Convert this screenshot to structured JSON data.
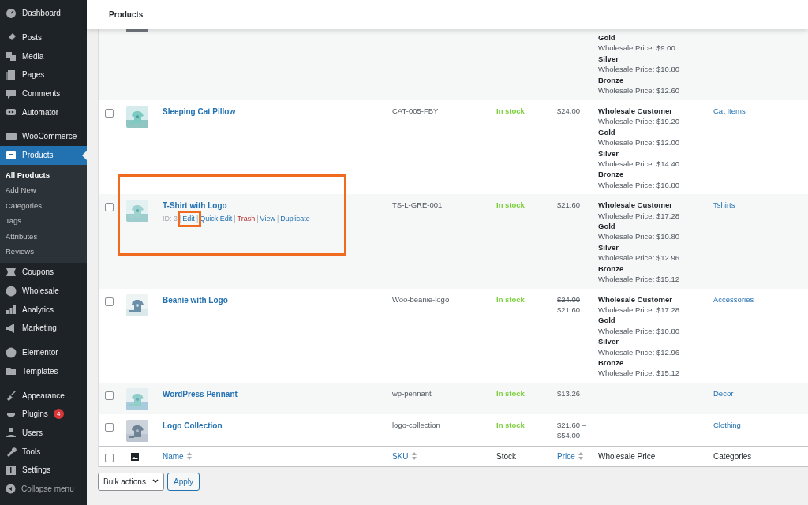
{
  "sidebar": {
    "groups": [
      [
        {
          "label": "Dashboard",
          "selected": false
        }
      ],
      [
        {
          "label": "Posts",
          "selected": false
        },
        {
          "label": "Media",
          "selected": false
        },
        {
          "label": "Pages",
          "selected": false
        },
        {
          "label": "Comments",
          "selected": false
        },
        {
          "label": "Automator",
          "selected": false
        }
      ],
      [
        {
          "label": "WooCommerce",
          "selected": false
        },
        {
          "label": "Products",
          "selected": true,
          "children": [
            {
              "label": "All Products",
              "selected": true
            },
            {
              "label": "Add New",
              "selected": false
            },
            {
              "label": "Categories",
              "selected": false
            },
            {
              "label": "Tags",
              "selected": false
            },
            {
              "label": "Attributes",
              "selected": false
            },
            {
              "label": "Reviews",
              "selected": false
            }
          ]
        },
        {
          "label": "Coupons",
          "selected": false
        },
        {
          "label": "Wholesale",
          "selected": false
        },
        {
          "label": "Analytics",
          "selected": false
        },
        {
          "label": "Marketing",
          "selected": false
        }
      ],
      [
        {
          "label": "Elementor",
          "selected": false
        },
        {
          "label": "Templates",
          "selected": false
        }
      ],
      [
        {
          "label": "Appearance",
          "selected": false
        },
        {
          "label": "Plugins",
          "selected": false,
          "badge": "4"
        },
        {
          "label": "Users",
          "selected": false
        },
        {
          "label": "Tools",
          "selected": false
        },
        {
          "label": "Settings",
          "selected": false
        }
      ]
    ],
    "collapse_label": "Collapse menu"
  },
  "header": {
    "title": "Products"
  },
  "rows": [
    {
      "cut_top": true,
      "wholesale": [
        {
          "tier": "Gold",
          "price": "Wholesale Price: $9.00"
        },
        {
          "tier": "Silver",
          "price": "Wholesale Price: $10.80"
        },
        {
          "tier": "Bronze",
          "price": "Wholesale Price: $12.60"
        }
      ]
    },
    {
      "checked": false,
      "name": "Sleeping Cat Pillow",
      "sku": "CAT-005-FBY",
      "stock": "In stock",
      "price": [
        {
          "text": "$24.00",
          "struck": false
        }
      ],
      "wholesale": [
        {
          "tier": "Wholesale Customer",
          "price": "Wholesale Price: $19.20"
        },
        {
          "tier": "Gold",
          "price": "Wholesale Price: $12.00"
        },
        {
          "tier": "Silver",
          "price": "Wholesale Price: $14.40"
        },
        {
          "tier": "Bronze",
          "price": "Wholesale Price: $16.80"
        }
      ],
      "category": "Cat Items"
    },
    {
      "checked": false,
      "highlighted": true,
      "name": "T-Shirt with Logo",
      "id_text": "ID: 3",
      "actions": [
        {
          "separator": "|",
          "label": "Edit",
          "kind": "link",
          "highlighted": true
        },
        {
          "separator": "|",
          "label": "Quick Edit",
          "kind": "link",
          "highlighted": false
        },
        {
          "separator": "|",
          "label": "Trash",
          "kind": "trash",
          "highlighted": false
        },
        {
          "separator": "|",
          "label": "View",
          "kind": "link",
          "highlighted": false
        },
        {
          "separator": "|",
          "label": "Duplicate",
          "kind": "link",
          "highlighted": false
        }
      ],
      "sku": "TS-L-GRE-001",
      "stock": "In stock",
      "price": [
        {
          "text": "$21.60",
          "struck": false
        }
      ],
      "wholesale": [
        {
          "tier": "Wholesale Customer",
          "price": "Wholesale Price: $17.28"
        },
        {
          "tier": "Gold",
          "price": "Wholesale Price: $10.80"
        },
        {
          "tier": "Silver",
          "price": "Wholesale Price: $12.96"
        },
        {
          "tier": "Bronze",
          "price": "Wholesale Price: $15.12"
        }
      ],
      "category": "Tshirts"
    },
    {
      "checked": false,
      "name": "Beanie with Logo",
      "sku": "Woo-beanie-logo",
      "stock": "In stock",
      "price": [
        {
          "text": "$24.00",
          "struck": true
        },
        {
          "text": "$21.60",
          "struck": false
        }
      ],
      "wholesale": [
        {
          "tier": "Wholesale Customer",
          "price": "Wholesale Price: $17.28"
        },
        {
          "tier": "Gold",
          "price": "Wholesale Price: $10.80"
        },
        {
          "tier": "Silver",
          "price": "Wholesale Price: $12.96"
        },
        {
          "tier": "Bronze",
          "price": "Wholesale Price: $15.12"
        }
      ],
      "category": "Accessories"
    },
    {
      "checked": false,
      "name": "WordPress Pennant",
      "sku": "wp-pennant",
      "stock": "In stock",
      "price": [
        {
          "text": "$13.26",
          "struck": false
        }
      ],
      "category": "Decor"
    },
    {
      "checked": false,
      "name": "Logo Collection",
      "sku": "logo-collection",
      "stock": "In stock",
      "price": [
        {
          "text": "$21.60 –",
          "struck": false
        },
        {
          "text": "$54.00",
          "struck": false
        }
      ],
      "category": "Clothing"
    }
  ],
  "footer": {
    "checked": false,
    "columns": [
      {
        "label": "Name",
        "sortable": true
      },
      {
        "label": "SKU",
        "sortable": true
      },
      {
        "label": "Stock",
        "sortable": false
      },
      {
        "label": "Price",
        "sortable": true
      },
      {
        "label": "Wholesale Price",
        "sortable": false
      },
      {
        "label": "Categories",
        "sortable": false
      }
    ]
  },
  "bulk": {
    "select": "Bulk actions",
    "button": "Apply"
  }
}
